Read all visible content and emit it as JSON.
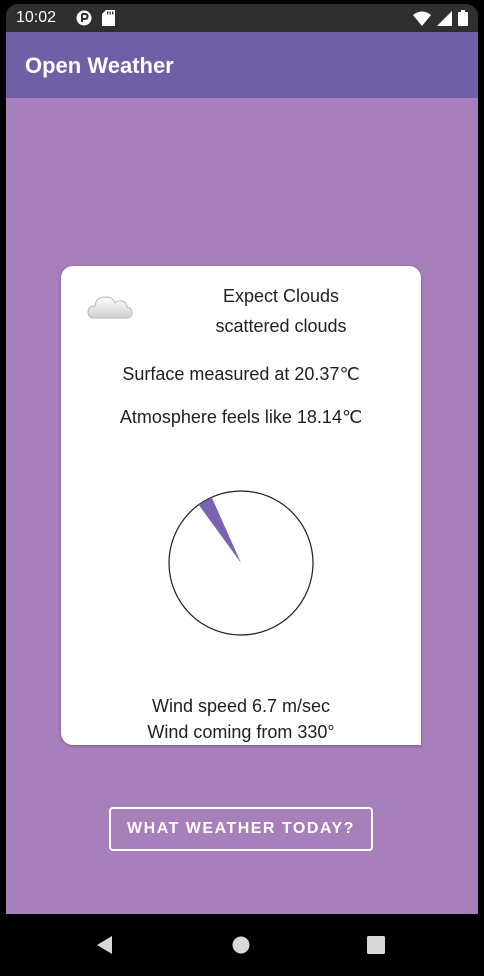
{
  "status_bar": {
    "time": "10:02",
    "left_icons": [
      "play-protect-icon",
      "sd-card-icon"
    ],
    "right_icons": [
      "wifi-icon",
      "signal-icon",
      "battery-icon"
    ]
  },
  "app_bar": {
    "title": "Open Weather"
  },
  "card": {
    "icon": "cloud-icon",
    "expect": "Expect Clouds",
    "description": "scattered clouds",
    "surface": "Surface measured at 20.37℃",
    "atmosphere": "Atmosphere feels like 18.14℃",
    "wind_direction_degrees": 330,
    "wind_speed": "Wind speed 6.7 m/sec",
    "wind_from": "Wind coming from 330°"
  },
  "button": {
    "label": "WHAT WEATHER TODAY?"
  },
  "nav_bar": {
    "icons": [
      "back-icon",
      "home-icon",
      "recents-icon"
    ]
  },
  "colors": {
    "app_bar": "#6f5fa6",
    "background": "#a77fbb",
    "needle": "#7a64b0"
  }
}
